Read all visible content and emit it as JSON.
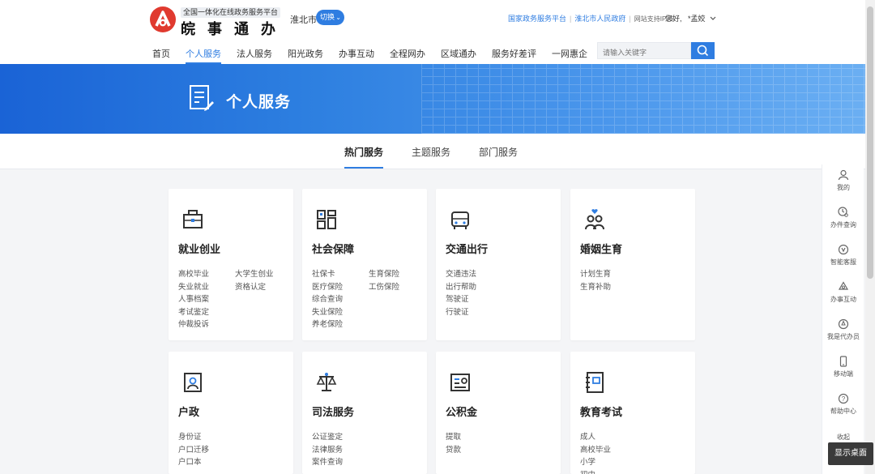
{
  "header": {
    "platform_subtitle": "全国一体化在线政务服务平台",
    "brand_name": "皖事通办",
    "city": "淮北市",
    "switch_label": "切换",
    "links": [
      "国家政务服务平台",
      "淮北市人民政府"
    ],
    "ipv6_label": "网站支持IPv6",
    "greeting": "您好,",
    "username": "*孟姣",
    "nav": [
      "首页",
      "个人服务",
      "法人服务",
      "阳光政务",
      "办事互动",
      "全程网办",
      "区域通办",
      "服务好差评",
      "一网惠企"
    ],
    "active_nav": "个人服务",
    "search_placeholder": "请输入关键字"
  },
  "banner": {
    "title": "个人服务"
  },
  "tabs": [
    "热门服务",
    "主题服务",
    "部门服务"
  ],
  "active_tab": "热门服务",
  "cards": [
    {
      "title": "就业创业",
      "icon": "briefcase-icon",
      "items": [
        "高校毕业",
        "大学生创业",
        "失业就业",
        "资格认定",
        "人事档案",
        "考试鉴定",
        "仲裁投诉"
      ]
    },
    {
      "title": "社会保障",
      "icon": "social-security-icon",
      "items": [
        "社保卡",
        "生育保险",
        "医疗保险",
        "工伤保险",
        "综合查询",
        "失业保险",
        "养老保险"
      ]
    },
    {
      "title": "交通出行",
      "icon": "car-icon",
      "items": [
        "交通违法",
        "出行帮助",
        "驾驶证",
        "行驶证"
      ]
    },
    {
      "title": "婚姻生育",
      "icon": "couple-icon",
      "items": [
        "计划生育",
        "生育补助"
      ]
    },
    {
      "title": "户政",
      "icon": "id-photo-icon",
      "items": [
        "身份证",
        "户口迁移",
        "户口本"
      ]
    },
    {
      "title": "司法服务",
      "icon": "scales-icon",
      "items": [
        "公证鉴定",
        "法律服务",
        "案件查询"
      ]
    },
    {
      "title": "公积金",
      "icon": "fund-card-icon",
      "items": [
        "提取",
        "贷款"
      ]
    },
    {
      "title": "教育考试",
      "icon": "book-icon",
      "items": [
        "成人",
        "高校毕业",
        "小学",
        "初中"
      ]
    }
  ],
  "side_panel": [
    "我的",
    "办件查询",
    "智能客服",
    "办事互动",
    "我是代办员",
    "移动端",
    "帮助中心",
    "收起"
  ],
  "tooltip": "显示桌面",
  "colors": {
    "accent": "#2f7de1",
    "brand_red": "#e03a2f"
  }
}
